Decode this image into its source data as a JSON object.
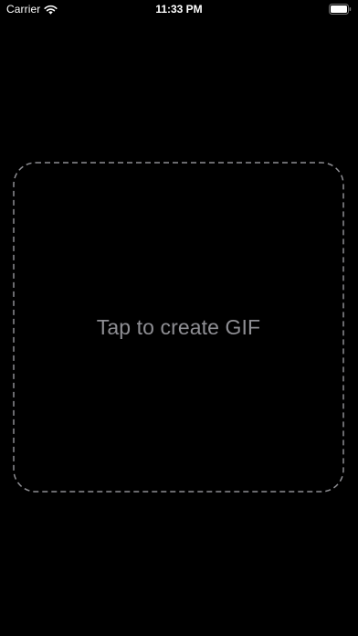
{
  "status_bar": {
    "carrier": "Carrier",
    "time": "11:33 PM",
    "wifi_icon": "wifi-icon",
    "battery_icon": "battery-icon"
  },
  "main": {
    "dropzone_label": "Tap to create GIF",
    "dropzone_icon": "dashed-border",
    "label_color": "#8e8e93",
    "border_color": "#8e8e93",
    "background_color": "#000000"
  }
}
